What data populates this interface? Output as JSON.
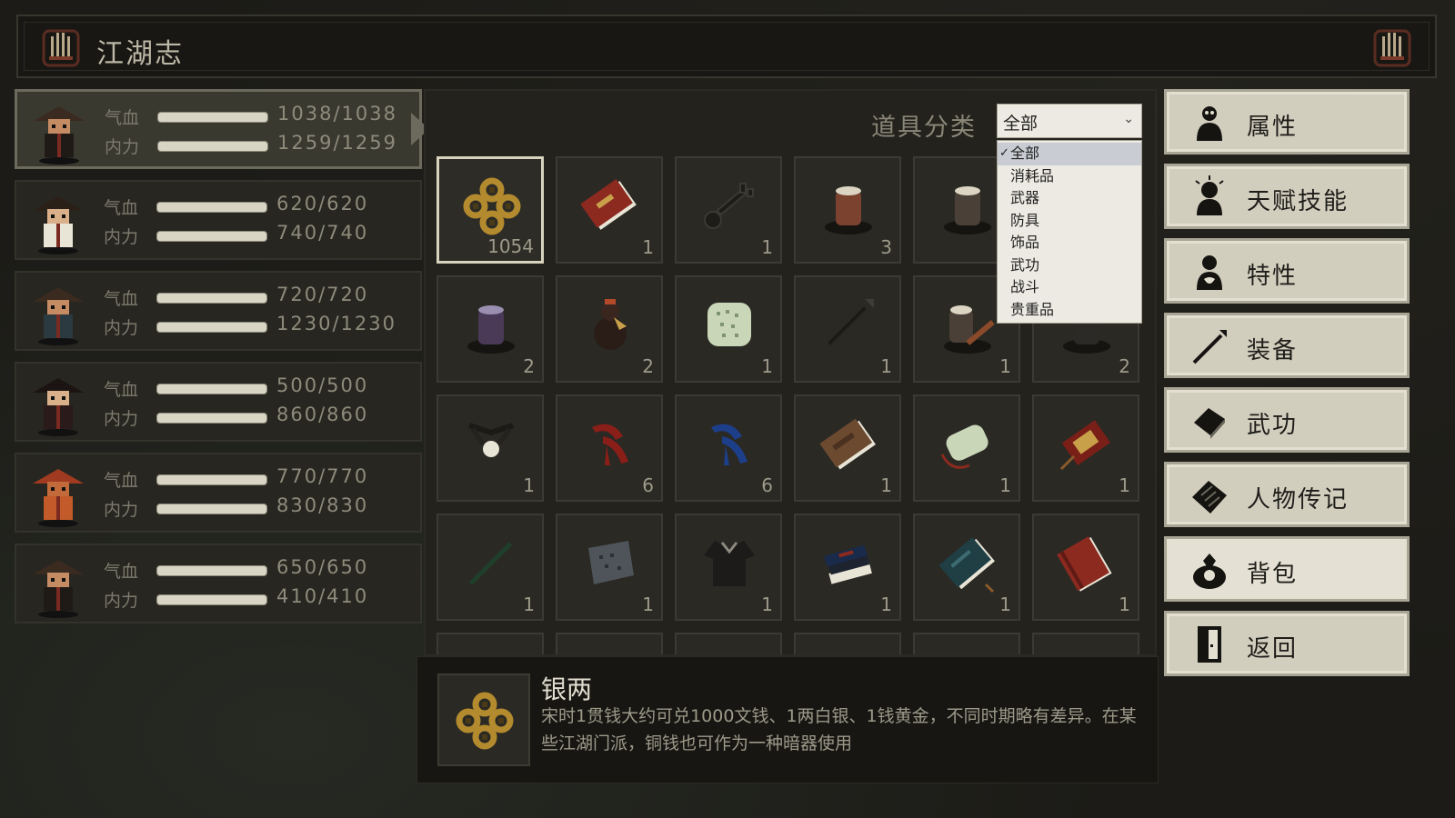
{
  "window": {
    "title": "江湖志"
  },
  "party": [
    {
      "hp_label": "气血",
      "mp_label": "内力",
      "hp": "1038/1038",
      "mp": "1259/1259",
      "selected": true
    },
    {
      "hp_label": "气血",
      "mp_label": "内力",
      "hp": "620/620",
      "mp": "740/740",
      "selected": false
    },
    {
      "hp_label": "气血",
      "mp_label": "内力",
      "hp": "720/720",
      "mp": "1230/1230",
      "selected": false
    },
    {
      "hp_label": "气血",
      "mp_label": "内力",
      "hp": "500/500",
      "mp": "860/860",
      "selected": false
    },
    {
      "hp_label": "气血",
      "mp_label": "内力",
      "hp": "770/770",
      "mp": "830/830",
      "selected": false
    },
    {
      "hp_label": "气血",
      "mp_label": "内力",
      "hp": "650/650",
      "mp": "410/410",
      "selected": false
    }
  ],
  "inventory": {
    "category_label": "道具分类",
    "category_selected": "全部",
    "category_options": [
      "全部",
      "消耗品",
      "武器",
      "防具",
      "饰品",
      "武功",
      "战斗",
      "贵重品"
    ],
    "items": [
      {
        "icon": "coins-icon",
        "count": "1054"
      },
      {
        "icon": "red-book-icon",
        "count": "1"
      },
      {
        "icon": "key-icon",
        "count": "1"
      },
      {
        "icon": "jar-brown-icon",
        "count": "3"
      },
      {
        "icon": "jar-dark-icon",
        "count": ""
      },
      {
        "icon": "",
        "count": ""
      },
      {
        "icon": "jar-purple-icon",
        "count": "2"
      },
      {
        "icon": "gourd-icon",
        "count": "2"
      },
      {
        "icon": "jade-disc-icon",
        "count": "1"
      },
      {
        "icon": "spear-icon",
        "count": "1"
      },
      {
        "icon": "jar-scroll-icon",
        "count": "1"
      },
      {
        "icon": "jar-black-icon",
        "count": "2"
      },
      {
        "icon": "pearl-necklace-icon",
        "count": "1"
      },
      {
        "icon": "red-feather-icon",
        "count": "6"
      },
      {
        "icon": "blue-feather-icon",
        "count": "6"
      },
      {
        "icon": "brown-book-icon",
        "count": "1"
      },
      {
        "icon": "jade-pendant-icon",
        "count": "1"
      },
      {
        "icon": "red-tag-icon",
        "count": "1"
      },
      {
        "icon": "bamboo-stick-icon",
        "count": "1"
      },
      {
        "icon": "map-cloth-icon",
        "count": "1"
      },
      {
        "icon": "black-robe-icon",
        "count": "1"
      },
      {
        "icon": "book-stack-icon",
        "count": "1"
      },
      {
        "icon": "teal-book-icon",
        "count": "1"
      },
      {
        "icon": "red-tome-icon",
        "count": "1"
      }
    ]
  },
  "detail": {
    "icon": "coins-icon",
    "name": "银两",
    "description": "宋时1贯钱大约可兑1000文钱、1两白银、1钱黄金，不同时期略有差异。在某些江湖门派，铜钱也可作为一种暗器使用"
  },
  "menu": [
    {
      "label": "属性",
      "icon": "person-icon",
      "active": false
    },
    {
      "label": "天赋技能",
      "icon": "talent-icon",
      "active": false
    },
    {
      "label": "特性",
      "icon": "trait-icon",
      "active": false
    },
    {
      "label": "装备",
      "icon": "spear-icon",
      "active": false
    },
    {
      "label": "武功",
      "icon": "manual-icon",
      "active": false
    },
    {
      "label": "人物传记",
      "icon": "biography-icon",
      "active": false
    },
    {
      "label": "背包",
      "icon": "bag-icon",
      "active": true
    },
    {
      "label": "返回",
      "icon": "door-icon",
      "active": false
    }
  ]
}
